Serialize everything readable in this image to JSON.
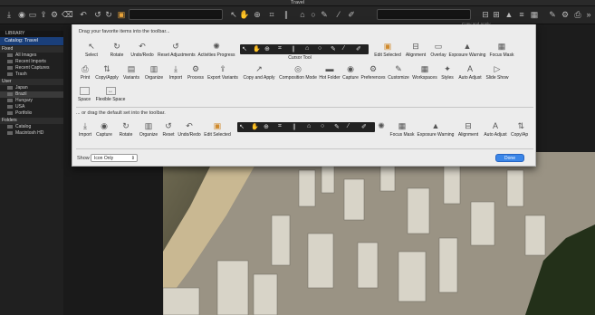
{
  "window": {
    "title": "Travel"
  },
  "toolbar": {
    "copy_apply_label": "Copy and Apply"
  },
  "sidebar": {
    "library_header": "LIBRARY",
    "catalog": "Catalog: Travel",
    "sections": [
      {
        "title": "Fixed",
        "items": [
          "All Images",
          "Recent Imports",
          "Recent Captures",
          "Trash"
        ]
      },
      {
        "title": "User",
        "items": [
          "Japan",
          "Brazil",
          "Hungary",
          "USA",
          "Portfolio"
        ]
      },
      {
        "title": "Folders",
        "items": [
          "Catalog",
          "Macintosh HD"
        ]
      }
    ]
  },
  "sheet": {
    "drag_favorites": "Drag your favorite items into the toolbar...",
    "drag_default": "... or drag the default set into the toolbar.",
    "show_label": "Show",
    "show_value": "Icon Only",
    "done_label": "Done",
    "row1": [
      "Select",
      "Rotate",
      "Undo/Redo",
      "Reset Adjustments",
      "Activities Progress",
      "Cursor Tool",
      "Edit Selected",
      "Alignment",
      "Overlay",
      "Exposure Warning",
      "Focus Mask"
    ],
    "row2": [
      "Print",
      "Copy/Apply",
      "Variants",
      "Organize",
      "Import",
      "Process",
      "Export Variants",
      "Copy and Apply",
      "Composition Mode",
      "Hot Folder",
      "Capture",
      "Preferences",
      "Customize",
      "Workspaces",
      "Styles",
      "Auto Adjust",
      "Slide Show"
    ],
    "row3": [
      "Space",
      "Flexible Space"
    ],
    "default_row": [
      "Import",
      "Capture",
      "Rotate",
      "Organize",
      "Reset",
      "Undo/Redo",
      "Edit Selected",
      "Focus Mask",
      "Exposure Warning",
      "Alignment",
      "Auto Adjust",
      "Copy/Ap"
    ]
  }
}
